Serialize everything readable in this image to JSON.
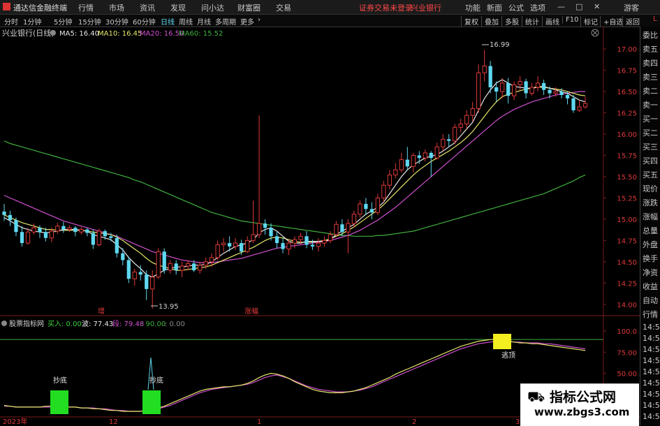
{
  "app": {
    "title": "通达信金融终端",
    "menu": [
      "行情",
      "市场",
      "资讯",
      "发现",
      "问小达",
      "财富圈",
      "交易"
    ],
    "notice": "证券交易未登录",
    "stock_name_top": "兴业银行",
    "right_menu": [
      "功能",
      "新面",
      "公式",
      "选项"
    ],
    "window_buttons": [
      "—",
      "□",
      "✕"
    ],
    "guest": "游客"
  },
  "toolbar": {
    "periods": [
      "分时",
      "1分钟",
      "5分钟",
      "15分钟",
      "30分钟",
      "60分钟",
      "日线",
      "周线",
      "月线",
      "多周期",
      "更多"
    ],
    "active_period": "日线",
    "right": [
      "复权",
      "叠加",
      "多股",
      "统计",
      "画线",
      "F10",
      "标记",
      "+自选",
      "返回"
    ]
  },
  "main_chart": {
    "title": "兴业银行(日线)",
    "ma_legend": [
      {
        "label": "MA5: 16.40",
        "color": "#e8e8e8"
      },
      {
        "label": "MA10: 16.45",
        "color": "#e6e66a"
      },
      {
        "label": "MA20: 16.50",
        "color": "#d050d0"
      },
      {
        "label": "MA60: 15.52",
        "color": "#3fb13f"
      }
    ],
    "high_label": "16.99",
    "low_label": "13.95",
    "annotation_zeng": "增",
    "annotation_zhangting": "涨幅",
    "y_ticks": [
      "17.00",
      "16.75",
      "16.50",
      "16.25",
      "16.00",
      "15.75",
      "15.50",
      "15.25",
      "15.00",
      "14.75",
      "14.50",
      "14.25",
      "14.00"
    ]
  },
  "indicator": {
    "title": "股票指标网",
    "values": [
      {
        "label": "买入: 0.00",
        "color": "#3fd23f"
      },
      {
        "label": "波: 77.43",
        "color": "#e8e8e8"
      },
      {
        "label": "段: 79.48",
        "color": "#d050d0"
      },
      {
        "label": ": 90.00",
        "color": "#3fb13f"
      },
      {
        "label": ": 0.00",
        "color": "#888888"
      }
    ],
    "y_ticks": [
      "100.0",
      "75.00",
      "50.00",
      "25.00"
    ],
    "signals": [
      "抄底",
      "抄底",
      "逃顶"
    ]
  },
  "x_axis": [
    "2023年",
    "12",
    "1",
    "2",
    "3"
  ],
  "right_panel": [
    "委比",
    "卖五",
    "卖四",
    "卖三",
    "卖二",
    "卖一",
    "买一",
    "买二",
    "买三",
    "买四",
    "买五",
    "现价",
    "涨跌",
    "涨幅",
    "总量",
    "外盘",
    "换手",
    "净资",
    "收益",
    "自动",
    "行情",
    "14:5",
    "14:5",
    "14:5",
    "14:5",
    "14:5",
    "14:5",
    "14:5",
    "14:5",
    "14:5",
    "14:5",
    "14:5"
  ],
  "corner_label": "L",
  "watermark": {
    "title": "指标公式网",
    "url": "www.zbgs3.com"
  },
  "colors": {
    "up": "#e03a3a",
    "down": "#5fd8f0",
    "ma5": "#e8e8e8",
    "ma10": "#e6e66a",
    "ma20": "#d050d0",
    "ma60": "#3fb13f",
    "signal_buy": "#22dd22",
    "signal_top": "#f2ee20"
  },
  "chart_data": {
    "type": "candlestick",
    "ylim": [
      13.9,
      17.1
    ],
    "candles": [
      [
        15.09,
        15.05,
        15.18,
        14.98
      ],
      [
        15.05,
        14.99,
        15.1,
        14.92
      ],
      [
        14.99,
        14.85,
        15.02,
        14.8
      ],
      [
        14.85,
        14.72,
        14.92,
        14.68
      ],
      [
        14.72,
        14.85,
        14.9,
        14.7
      ],
      [
        14.85,
        14.9,
        14.95,
        14.82
      ],
      [
        14.9,
        14.85,
        14.93,
        14.78
      ],
      [
        14.85,
        14.78,
        14.9,
        14.74
      ],
      [
        14.78,
        14.86,
        14.9,
        14.73
      ],
      [
        14.86,
        14.92,
        14.96,
        14.83
      ],
      [
        14.92,
        14.88,
        14.97,
        14.84
      ],
      [
        14.88,
        14.9,
        14.93,
        14.85
      ],
      [
        14.9,
        14.85,
        14.92,
        14.8
      ],
      [
        14.85,
        14.88,
        14.91,
        14.82
      ],
      [
        14.88,
        14.84,
        14.9,
        14.8
      ],
      [
        14.84,
        14.7,
        14.88,
        14.65
      ],
      [
        14.7,
        14.86,
        14.89,
        14.68
      ],
      [
        14.86,
        14.8,
        14.88,
        14.76
      ],
      [
        14.8,
        14.78,
        14.84,
        14.74
      ],
      [
        14.78,
        14.6,
        14.82,
        14.55
      ],
      [
        14.6,
        14.52,
        14.66,
        14.46
      ],
      [
        14.52,
        14.3,
        14.56,
        14.25
      ],
      [
        14.3,
        14.38,
        14.42,
        14.22
      ],
      [
        14.38,
        14.35,
        14.46,
        14.28
      ],
      [
        14.35,
        14.18,
        14.4,
        14.05
      ],
      [
        14.18,
        14.32,
        14.4,
        13.95
      ],
      [
        14.32,
        14.62,
        14.66,
        14.3
      ],
      [
        14.62,
        14.4,
        14.66,
        14.36
      ],
      [
        14.4,
        14.48,
        14.52,
        14.36
      ],
      [
        14.48,
        14.4,
        14.52,
        14.35
      ],
      [
        14.4,
        14.45,
        14.5,
        14.32
      ],
      [
        14.45,
        14.48,
        14.52,
        14.4
      ],
      [
        14.48,
        14.4,
        14.52,
        14.38
      ],
      [
        14.4,
        14.46,
        14.5,
        14.36
      ],
      [
        14.46,
        14.5,
        14.55,
        14.42
      ],
      [
        14.5,
        14.55,
        14.6,
        14.44
      ],
      [
        14.55,
        14.7,
        14.75,
        14.52
      ],
      [
        14.7,
        14.72,
        14.78,
        14.62
      ],
      [
        14.72,
        14.68,
        14.8,
        14.62
      ],
      [
        14.68,
        14.72,
        14.78,
        14.64
      ],
      [
        14.72,
        14.62,
        14.76,
        14.58
      ],
      [
        14.62,
        14.75,
        14.8,
        14.6
      ],
      [
        14.75,
        14.82,
        15.22,
        14.72
      ],
      [
        14.82,
        14.95,
        16.22,
        14.78
      ],
      [
        14.95,
        14.9,
        15.0,
        14.82
      ],
      [
        14.9,
        14.8,
        14.95,
        14.75
      ],
      [
        14.8,
        14.72,
        14.85,
        14.66
      ],
      [
        14.72,
        14.65,
        14.78,
        14.6
      ],
      [
        14.65,
        14.72,
        14.76,
        14.58
      ],
      [
        14.72,
        14.76,
        14.8,
        14.66
      ],
      [
        14.76,
        14.8,
        14.84,
        14.7
      ],
      [
        14.8,
        14.7,
        14.86,
        14.66
      ],
      [
        14.7,
        14.68,
        14.76,
        14.64
      ],
      [
        14.68,
        14.72,
        14.78,
        14.62
      ],
      [
        14.72,
        14.75,
        14.8,
        14.68
      ],
      [
        14.75,
        14.82,
        14.86,
        14.72
      ],
      [
        14.82,
        14.94,
        14.98,
        14.8
      ],
      [
        14.94,
        14.85,
        15.0,
        14.8
      ],
      [
        14.85,
        14.95,
        15.0,
        14.6
      ],
      [
        14.95,
        15.06,
        15.1,
        14.9
      ],
      [
        15.06,
        15.18,
        15.22,
        15.02
      ],
      [
        15.18,
        15.12,
        15.25,
        15.05
      ],
      [
        15.12,
        15.08,
        15.2,
        15.0
      ],
      [
        15.08,
        15.25,
        15.3,
        15.05
      ],
      [
        15.25,
        15.4,
        15.45,
        15.2
      ],
      [
        15.4,
        15.52,
        15.58,
        15.35
      ],
      [
        15.52,
        15.58,
        15.66,
        15.48
      ],
      [
        15.58,
        15.7,
        15.78,
        15.55
      ],
      [
        15.7,
        15.62,
        15.85,
        15.58
      ],
      [
        15.62,
        15.75,
        15.78,
        15.55
      ],
      [
        15.75,
        15.72,
        15.8,
        15.65
      ],
      [
        15.72,
        15.78,
        15.82,
        15.68
      ],
      [
        15.78,
        15.72,
        15.8,
        15.5
      ],
      [
        15.72,
        15.85,
        15.9,
        15.7
      ],
      [
        15.85,
        15.94,
        16.0,
        15.8
      ],
      [
        15.94,
        15.92,
        16.0,
        15.85
      ],
      [
        15.92,
        16.08,
        16.12,
        15.88
      ],
      [
        16.08,
        16.12,
        16.18,
        16.02
      ],
      [
        16.12,
        16.22,
        16.28,
        16.06
      ],
      [
        16.22,
        16.3,
        16.38,
        16.15
      ],
      [
        16.3,
        16.72,
        16.82,
        16.25
      ],
      [
        16.72,
        16.8,
        16.99,
        16.62
      ],
      [
        16.8,
        16.55,
        16.86,
        16.48
      ],
      [
        16.55,
        16.5,
        16.62,
        16.38
      ],
      [
        16.5,
        16.6,
        16.66,
        16.42
      ],
      [
        16.6,
        16.45,
        16.66,
        16.36
      ],
      [
        16.45,
        16.58,
        16.62,
        16.4
      ],
      [
        16.58,
        16.62,
        16.68,
        16.52
      ],
      [
        16.62,
        16.48,
        16.65,
        16.42
      ],
      [
        16.48,
        16.55,
        16.6,
        16.45
      ],
      [
        16.55,
        16.6,
        16.68,
        16.5
      ],
      [
        16.6,
        16.52,
        16.64,
        16.46
      ],
      [
        16.52,
        16.48,
        16.56,
        16.42
      ],
      [
        16.48,
        16.5,
        16.55,
        16.44
      ],
      [
        16.5,
        16.46,
        16.54,
        16.42
      ],
      [
        16.46,
        16.42,
        16.5,
        16.35
      ],
      [
        16.42,
        16.28,
        16.46,
        16.25
      ],
      [
        16.28,
        16.32,
        16.4,
        16.26
      ],
      [
        16.32,
        16.36,
        16.44,
        16.3
      ]
    ],
    "ma5": [
      15.02,
      14.98,
      14.94,
      14.9,
      14.88,
      14.86,
      14.85,
      14.84,
      14.85,
      14.86,
      14.88,
      14.88,
      14.88,
      14.87,
      14.86,
      14.82,
      14.8,
      14.78,
      14.76,
      14.7,
      14.64,
      14.55,
      14.48,
      14.42,
      14.35,
      14.32,
      14.36,
      14.4,
      14.42,
      14.44,
      14.44,
      14.45,
      14.46,
      14.46,
      14.47,
      14.5,
      14.55,
      14.6,
      14.64,
      14.68,
      14.7,
      14.72,
      14.76,
      14.84,
      14.88,
      14.9,
      14.86,
      14.8,
      14.74,
      14.72,
      14.72,
      14.74,
      14.74,
      14.74,
      14.74,
      14.76,
      14.82,
      14.86,
      14.9,
      14.94,
      15.0,
      15.06,
      15.1,
      15.14,
      15.2,
      15.3,
      15.4,
      15.5,
      15.58,
      15.64,
      15.68,
      15.72,
      15.74,
      15.76,
      15.8,
      15.85,
      15.9,
      15.98,
      16.06,
      16.14,
      16.28,
      16.42,
      16.52,
      16.6,
      16.64,
      16.6,
      16.56,
      16.55,
      16.54,
      16.54,
      16.56,
      16.56,
      16.54,
      16.52,
      16.5,
      16.48,
      16.44,
      16.4,
      16.38
    ],
    "ma10": [
      15.05,
      15.02,
      14.99,
      14.96,
      14.94,
      14.92,
      14.9,
      14.88,
      14.88,
      14.87,
      14.87,
      14.87,
      14.87,
      14.87,
      14.86,
      14.85,
      14.84,
      14.83,
      14.82,
      14.79,
      14.75,
      14.7,
      14.65,
      14.6,
      14.54,
      14.49,
      14.46,
      14.44,
      14.42,
      14.4,
      14.4,
      14.41,
      14.42,
      14.43,
      14.44,
      14.46,
      14.49,
      14.52,
      14.55,
      14.58,
      14.61,
      14.64,
      14.67,
      14.71,
      14.75,
      14.78,
      14.79,
      14.78,
      14.76,
      14.74,
      14.73,
      14.73,
      14.73,
      14.74,
      14.75,
      14.77,
      14.8,
      14.83,
      14.87,
      14.91,
      14.96,
      15.01,
      15.06,
      15.11,
      15.17,
      15.24,
      15.31,
      15.38,
      15.45,
      15.52,
      15.58,
      15.63,
      15.68,
      15.72,
      15.76,
      15.8,
      15.85,
      15.9,
      15.96,
      16.03,
      16.12,
      16.21,
      16.3,
      16.38,
      16.44,
      16.47,
      16.49,
      16.51,
      16.53,
      16.54,
      16.55,
      16.55,
      16.54,
      16.53,
      16.52,
      16.5,
      16.48,
      16.46,
      16.45
    ],
    "ma20": [
      15.28,
      15.25,
      15.22,
      15.19,
      15.16,
      15.13,
      15.1,
      15.07,
      15.04,
      15.01,
      14.98,
      14.96,
      14.94,
      14.92,
      14.9,
      14.88,
      14.86,
      14.84,
      14.82,
      14.8,
      14.77,
      14.74,
      14.71,
      14.68,
      14.65,
      14.62,
      14.6,
      14.58,
      14.56,
      14.54,
      14.52,
      14.51,
      14.5,
      14.49,
      14.49,
      14.49,
      14.5,
      14.51,
      14.52,
      14.53,
      14.54,
      14.56,
      14.58,
      14.6,
      14.62,
      14.64,
      14.66,
      14.67,
      14.68,
      14.69,
      14.7,
      14.71,
      14.72,
      14.73,
      14.74,
      14.75,
      14.77,
      14.79,
      14.81,
      14.84,
      14.87,
      14.91,
      14.95,
      14.99,
      15.04,
      15.09,
      15.14,
      15.2,
      15.26,
      15.32,
      15.38,
      15.44,
      15.5,
      15.56,
      15.62,
      15.68,
      15.74,
      15.8,
      15.86,
      15.92,
      15.98,
      16.04,
      16.1,
      16.16,
      16.21,
      16.25,
      16.29,
      16.32,
      16.35,
      16.38,
      16.4,
      16.42,
      16.44,
      16.46,
      16.47,
      16.48,
      16.49,
      16.5,
      16.5
    ],
    "ma60": [
      15.92,
      15.89,
      15.87,
      15.85,
      15.83,
      15.81,
      15.79,
      15.77,
      15.75,
      15.73,
      15.71,
      15.69,
      15.67,
      15.65,
      15.63,
      15.61,
      15.59,
      15.57,
      15.55,
      15.53,
      15.51,
      15.49,
      15.46,
      15.44,
      15.41,
      15.38,
      15.35,
      15.32,
      15.29,
      15.26,
      15.23,
      15.2,
      15.17,
      15.14,
      15.11,
      15.08,
      15.06,
      15.04,
      15.02,
      15.0,
      14.98,
      14.97,
      14.96,
      14.95,
      14.94,
      14.93,
      14.92,
      14.91,
      14.9,
      14.89,
      14.88,
      14.87,
      14.86,
      14.85,
      14.84,
      14.83,
      14.82,
      14.81,
      14.81,
      14.8,
      14.8,
      14.8,
      14.8,
      14.81,
      14.81,
      14.82,
      14.83,
      14.84,
      14.85,
      14.86,
      14.88,
      14.9,
      14.92,
      14.94,
      14.96,
      14.98,
      15.0,
      15.02,
      15.04,
      15.06,
      15.08,
      15.1,
      15.12,
      15.14,
      15.16,
      15.18,
      15.2,
      15.22,
      15.24,
      15.26,
      15.28,
      15.3,
      15.33,
      15.36,
      15.39,
      15.42,
      15.45,
      15.49,
      15.52
    ],
    "indicator_ylim": [
      0,
      110
    ],
    "indicator_level": 90,
    "bo": [
      12,
      11,
      10,
      10,
      10,
      10,
      10,
      11,
      11,
      11,
      10,
      10,
      10,
      9,
      9,
      8,
      8,
      7,
      6,
      6,
      5,
      5,
      5,
      5,
      6,
      7,
      9,
      11,
      14,
      17,
      20,
      23,
      26,
      29,
      31,
      32,
      33,
      34,
      34,
      35,
      36,
      38,
      41,
      45,
      48,
      50,
      49,
      47,
      44,
      40,
      37,
      34,
      31,
      29,
      28,
      27,
      27,
      27,
      28,
      29,
      31,
      33,
      36,
      39,
      42,
      45,
      49,
      52,
      55,
      58,
      61,
      64,
      67,
      70,
      73,
      76,
      79,
      82,
      84,
      86,
      88,
      89,
      90,
      90,
      89,
      88,
      87,
      86,
      86,
      85,
      85,
      84,
      83,
      82,
      81,
      80,
      79,
      78,
      77
    ],
    "duan": [
      11,
      11,
      10,
      10,
      10,
      10,
      10,
      10,
      10,
      10,
      10,
      10,
      10,
      9,
      9,
      9,
      8,
      8,
      7,
      6,
      6,
      5,
      5,
      5,
      6,
      7,
      8,
      10,
      12,
      15,
      18,
      21,
      24,
      27,
      29,
      31,
      32,
      33,
      34,
      35,
      36,
      37,
      39,
      42,
      45,
      47,
      48,
      46,
      44,
      41,
      38,
      35,
      33,
      31,
      30,
      29,
      28,
      28,
      28,
      29,
      30,
      32,
      34,
      37,
      40,
      43,
      46,
      49,
      52,
      55,
      58,
      61,
      64,
      67,
      70,
      73,
      76,
      79,
      81,
      83,
      85,
      86,
      87,
      88,
      88,
      88,
      87,
      87,
      86,
      86,
      86,
      85,
      85,
      84,
      83,
      82,
      81,
      80,
      79
    ]
  }
}
